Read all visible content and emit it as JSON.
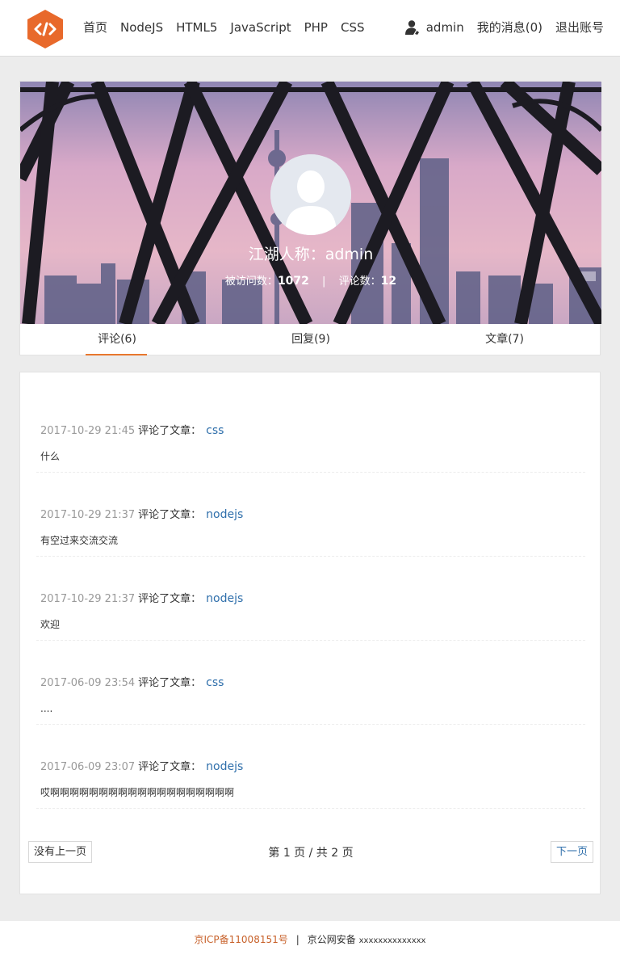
{
  "header": {
    "logo_icon": "code-brackets-icon",
    "nav": [
      "首页",
      "NodeJS",
      "HTML5",
      "JavaScript",
      "PHP",
      "CSS"
    ],
    "user_icon": "user-icon",
    "username": "admin",
    "messages": "我的消息(0)",
    "logout": "退出账号"
  },
  "profile": {
    "nickname": "江湖人称：admin",
    "visits_label": "被访问数：",
    "visits": "1072",
    "separator": "|",
    "comments_label": "评论数：",
    "comments": "12",
    "tabs": [
      {
        "label": "评论(6)",
        "active": true
      },
      {
        "label": "回复(9)",
        "active": false
      },
      {
        "label": "文章(7)",
        "active": false
      }
    ]
  },
  "comments": [
    {
      "time": "2017-10-29 21:45",
      "action": "评论了文章：",
      "article": "css",
      "content": "什么"
    },
    {
      "time": "2017-10-29 21:37",
      "action": "评论了文章：",
      "article": "nodejs",
      "content": "有空过来交流交流"
    },
    {
      "time": "2017-10-29 21:37",
      "action": "评论了文章：",
      "article": "nodejs",
      "content": "欢迎"
    },
    {
      "time": "2017-06-09 23:54",
      "action": "评论了文章：",
      "article": "css",
      "content": "...."
    },
    {
      "time": "2017-06-09 23:07",
      "action": "评论了文章：",
      "article": "nodejs",
      "content": "哎啊啊啊啊啊啊啊啊啊啊啊啊啊啊啊啊啊啊啊"
    }
  ],
  "pagination": {
    "prev": "没有上一页",
    "info": "第 1 页 / 共 2 页",
    "next": "下一页"
  },
  "footer": {
    "icp": "京ICP备11008151号",
    "separator": "|",
    "police": "京公网安备",
    "police_num": "xxxxxxxxxxxxxx"
  },
  "colors": {
    "accent": "#e8772e",
    "link": "#2f6fab",
    "icp": "#c8622b"
  }
}
